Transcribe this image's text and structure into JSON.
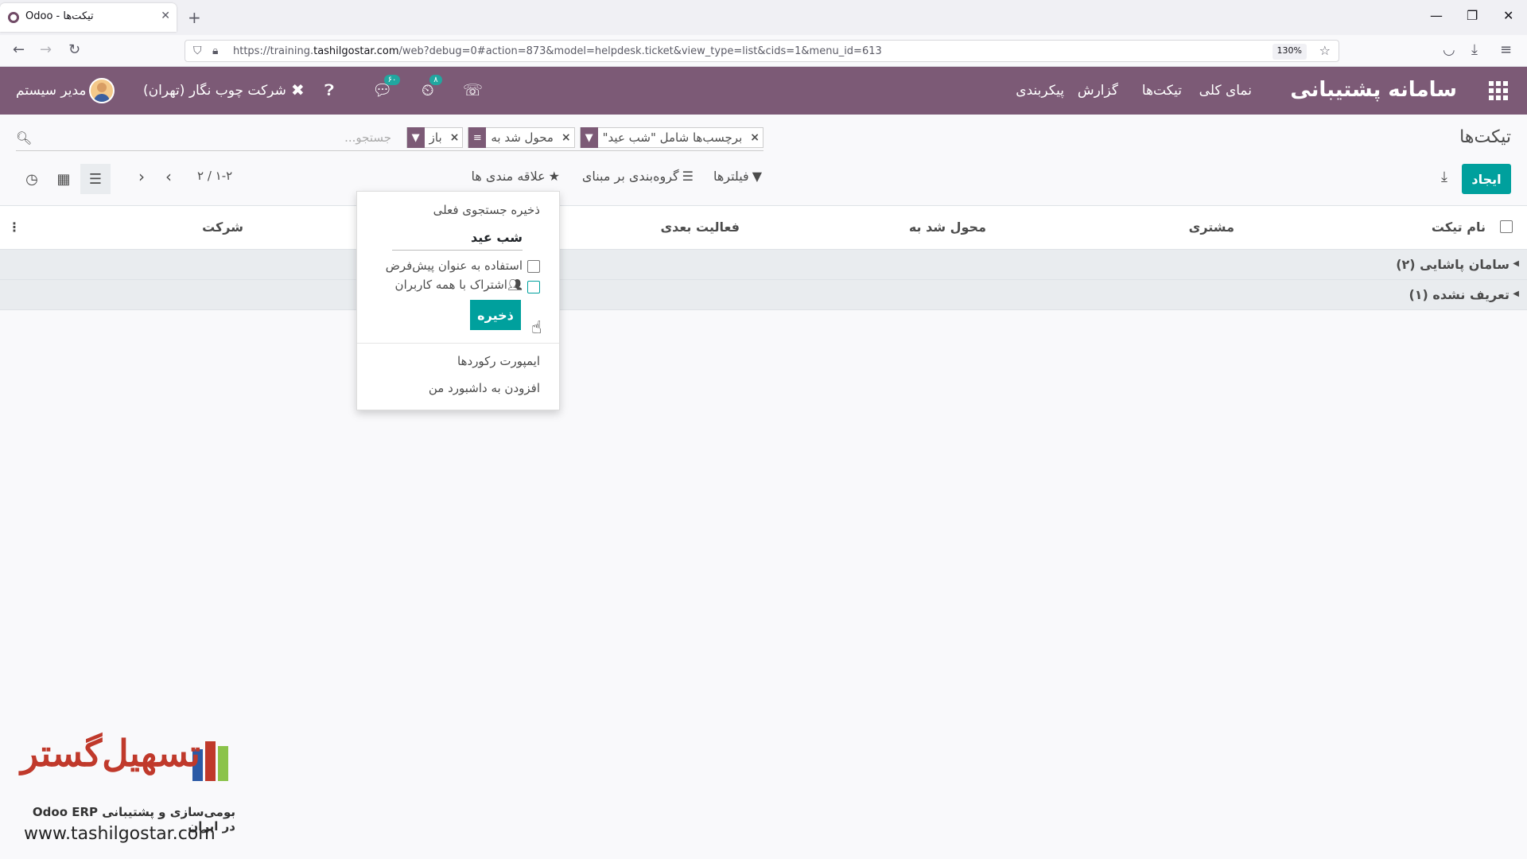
{
  "browser": {
    "tab_title": "تیکت‌ها - Odoo",
    "url_host": "https://training.",
    "url_domain": "tashilgostar.com",
    "url_path": "/web?debug=0#action=873&model=helpdesk.ticket&view_type=list&cids=1&menu_id=613",
    "zoom": "130%"
  },
  "odoo_nav": {
    "brand": "سامانه پشتیبانی",
    "menu": [
      "نمای کلی",
      "تیکت‌ها",
      "گزارش",
      "پیکربندی"
    ],
    "chat_badge": "۶۰",
    "activity_badge": "۸",
    "company": "شرکت چوب نگار (تهران)",
    "user": "مدیر سیستم"
  },
  "control_panel": {
    "title": "تیکت‌ها",
    "search_placeholder": "جستجو...",
    "facets": [
      {
        "icon": "filter",
        "value": "باز"
      },
      {
        "icon": "group",
        "value": "محول شد به"
      },
      {
        "icon": "filter",
        "value": "برچسب‌ها شامل \"شب عید\""
      }
    ],
    "create_label": "ایجاد",
    "filters_label": "فیلترها",
    "groupby_label": "گروه‌بندی بر مبنای",
    "favorites_label": "علاقه مندی ها",
    "pager": "۱-۲ / ۲"
  },
  "list": {
    "headers": {
      "name": "نام تیکت",
      "customer": "مشتری",
      "assigned": "محول شد به",
      "next_activity": "فعالیت بعدی",
      "company": "شرکت"
    },
    "groups": [
      "سامان پاشایی (۲)",
      "تعریف نشده (۱)"
    ]
  },
  "favorites_dropdown": {
    "title": "ذخیره جستجوی فعلی",
    "name_value": "شب عید",
    "use_default": "استفاده به عنوان پیش‌فرض",
    "share_all": "اشتراک با همه کاربران",
    "save_label": "ذخیره",
    "import_records": "ایمپورت رکوردها",
    "add_dashboard": "افزودن به داشبورد من"
  },
  "watermark": {
    "brand": "تسهیل‌گستر",
    "subtitle": "بومی‌سازی و پشتیبانی Odoo ERP در ایران",
    "url": "www.tashilgostar.com"
  },
  "colors": {
    "primary": "#7c5a76",
    "accent": "#00a09d"
  }
}
